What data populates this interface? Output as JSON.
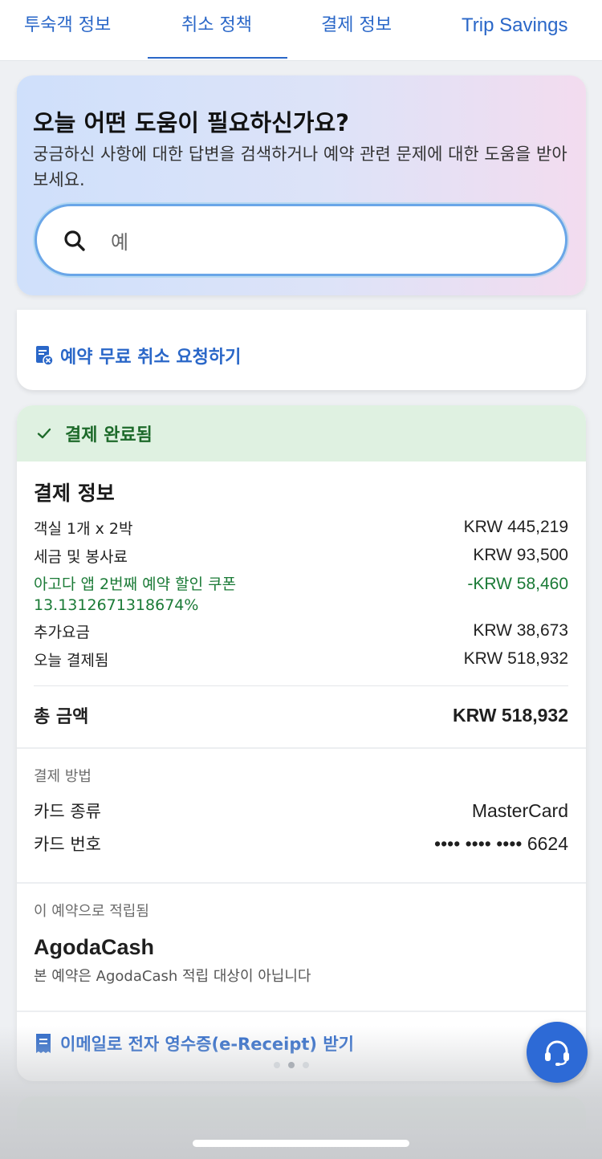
{
  "tabs": [
    {
      "label": "투숙객 정보"
    },
    {
      "label": "취소 정책"
    },
    {
      "label": "결제 정보"
    },
    {
      "label": "Trip Savings"
    }
  ],
  "help": {
    "title": "오늘 어떤 도움이 필요하신가요?",
    "description": "궁금하신 사항에 대한 답변을 검색하거나 예약 관련 문제에 대한 도움을 받아보세요.",
    "search_value": "예"
  },
  "cancel": {
    "link_label": "예약 무료 취소 요청하기"
  },
  "payment": {
    "status": "결제 완료됨",
    "section_title": "결제 정보",
    "lines": {
      "room_label": "객실 1개 x 2박",
      "room_value": "KRW 445,219",
      "tax_label": "세금 및 봉사료",
      "tax_value": "KRW 93,500",
      "discount_label": "아고다 앱 2번째 예약 할인 쿠폰 13.1312671318674%",
      "discount_value": "-KRW 58,460",
      "extra_label": "추가요금",
      "extra_value": "KRW 38,673",
      "paid_today_label": "오늘 결제됨",
      "paid_today_value": "KRW 518,932"
    },
    "total_label": "총 금액",
    "total_value": "KRW 518,932",
    "method_heading": "결제 방법",
    "card_type_label": "카드 종류",
    "card_type_value": "MasterCard",
    "card_number_label": "카드 번호",
    "card_number_value": "•••• •••• •••• 6624",
    "earned_heading": "이 예약으로 적립됨",
    "cash_title": "AgodaCash",
    "cash_desc": "본 예약은 AgodaCash 적립 대상이 아닙니다",
    "receipt_link": "이메일로 전자 영수증(e-Receipt) 받기"
  },
  "colors": {
    "accent": "#2a67c8",
    "success": "#1a7a36",
    "success_bg": "#dff1e1",
    "fab": "#2d6ad6"
  },
  "icons": {
    "search": "search-icon",
    "cancel_doc": "document-cancel-icon",
    "check": "check-icon",
    "receipt": "receipt-icon",
    "support": "headset-icon"
  }
}
